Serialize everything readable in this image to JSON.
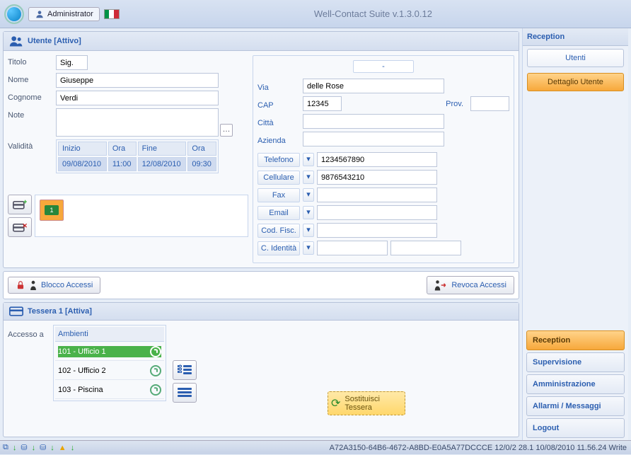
{
  "app": {
    "title": "Well-Contact Suite v.1.3.0.12",
    "user": "Administrator"
  },
  "utente": {
    "header": "Utente [Attivo]",
    "labels": {
      "titolo": "Titolo",
      "nome": "Nome",
      "cognome": "Cognome",
      "note": "Note",
      "validita": "Validità"
    },
    "values": {
      "titolo": "Sig.",
      "nome": "Giuseppe",
      "cognome": "Verdi",
      "note": ""
    },
    "validita": {
      "cols": {
        "inizio": "Inizio",
        "ora1": "Ora",
        "fine": "Fine",
        "ora2": "Ora"
      },
      "row": {
        "inizio": "09/08/2010",
        "ora1": "11:00",
        "fine": "12/08/2010",
        "ora2": "09:30"
      }
    },
    "card_number": "1",
    "col2": {
      "dash": "-",
      "labels": {
        "via": "Via",
        "cap": "CAP",
        "prov": "Prov.",
        "citta": "Città",
        "azienda": "Azienda"
      },
      "values": {
        "via": "delle Rose",
        "cap": "12345",
        "prov": "",
        "citta": "",
        "azienda": ""
      },
      "contacts": {
        "telefono": {
          "label": "Telefono",
          "value": "1234567890"
        },
        "cellulare": {
          "label": "Cellulare",
          "value": "9876543210"
        },
        "fax": {
          "label": "Fax",
          "value": ""
        },
        "email": {
          "label": "Email",
          "value": ""
        },
        "codfisc": {
          "label": "Cod. Fisc.",
          "value": ""
        },
        "cidentita": {
          "label": "C. Identità",
          "value1": "",
          "value2": ""
        }
      }
    }
  },
  "access_bar": {
    "blocco": "Blocco Accessi",
    "revoca": "Revoca Accessi"
  },
  "tessera": {
    "header": "Tessera 1 [Attiva]",
    "accesso_label": "Accesso a",
    "ambienti_header": "Ambienti",
    "items": [
      {
        "label": "101 - Ufficio 1",
        "active": true
      },
      {
        "label": "102 - Ufficio 2",
        "active": false
      },
      {
        "label": "103 - Piscina",
        "active": false
      }
    ],
    "sostituisci": "Sostituisci Tessera"
  },
  "right": {
    "header": "Reception",
    "buttons": {
      "utenti": "Utenti",
      "dettaglio": "Dettaglio Utente"
    },
    "nav": {
      "reception": "Reception",
      "supervisione": "Supervisione",
      "amministrazione": "Amministrazione",
      "allarmi": "Allarmi / Messaggi",
      "logout": "Logout"
    }
  },
  "status": {
    "text": "A72A3150-64B6-4672-A8BD-E0A5A77DCCCE 12/0/2 28.1 10/08/2010 11.56.24 Write"
  }
}
